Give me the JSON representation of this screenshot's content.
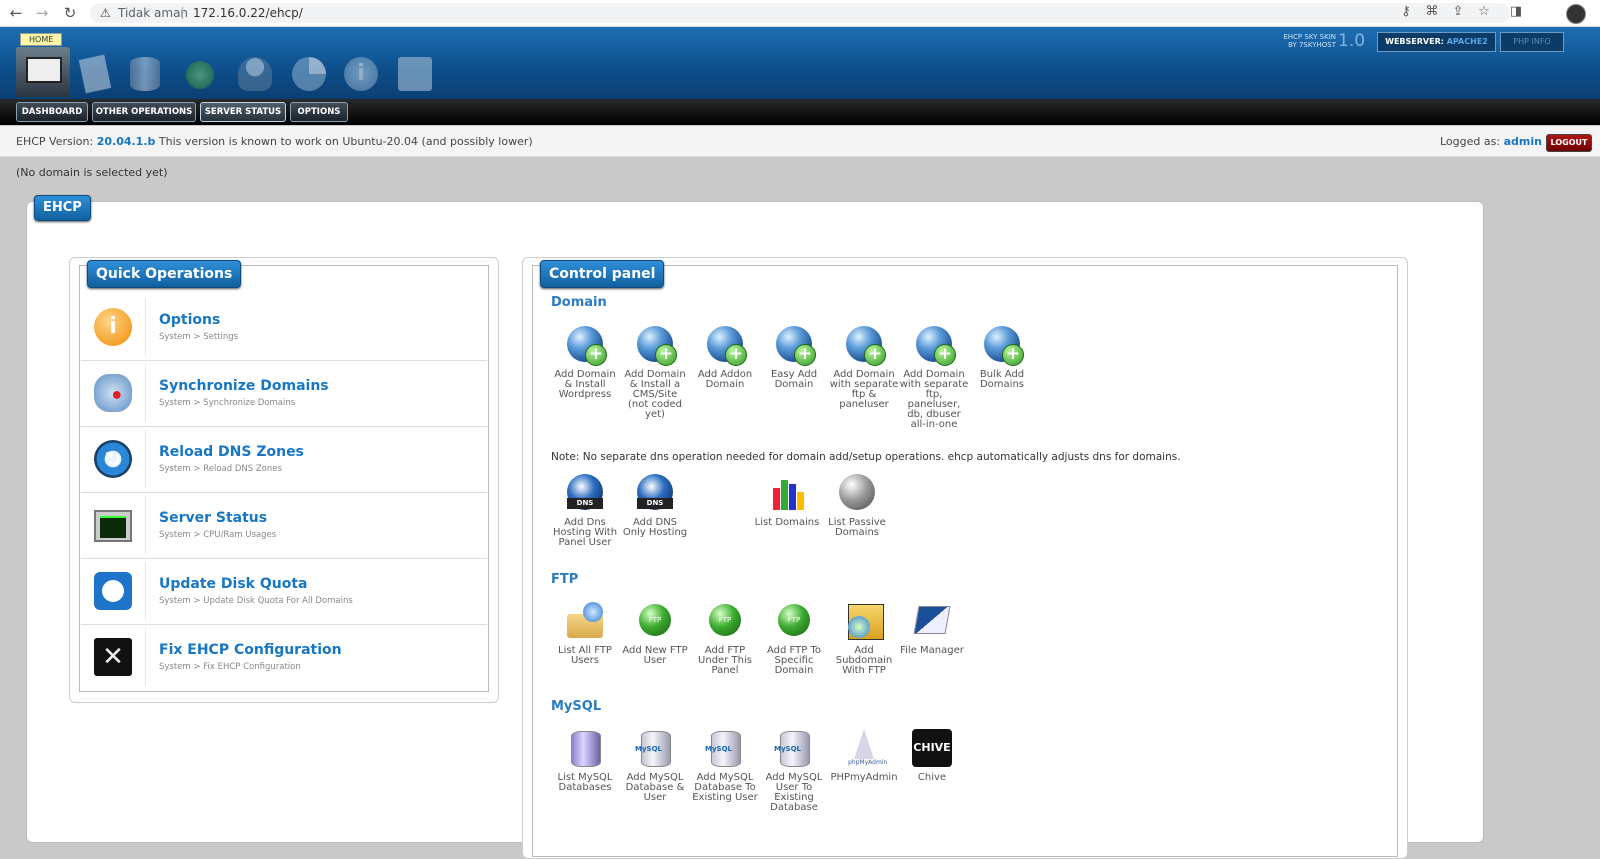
{
  "browser": {
    "security_label": "Tidak aman",
    "url": "172.16.0.22/ehcp/"
  },
  "header": {
    "home_tooltip": "HOME",
    "skin_line1": "EHCP SKY SKIN",
    "skin_line2": "BY 7SKYHOST",
    "skin_version": "1.0",
    "webserver_label": "WEBSERVER:",
    "webserver_value": "APACHE2",
    "php_info": "PHP INFO"
  },
  "menu": {
    "items": [
      "DASHBOARD",
      "OTHER OPERATIONS",
      "SERVER STATUS",
      "OPTIONS"
    ]
  },
  "version_bar": {
    "prefix": "EHCP Version:",
    "version": "20.04.1.b",
    "suffix": "This version is known to work on Ubuntu-20.04 (and possibly lower)",
    "logged_as": "Logged as:",
    "user": "admin",
    "logout": "LOGOUT"
  },
  "domain_status": "(No domain is selected yet)",
  "main": {
    "title": "EHCP",
    "quick_ops": {
      "title": "Quick Operations",
      "items": [
        {
          "title": "Options",
          "sub": "System > Settings",
          "icon": "info-icon"
        },
        {
          "title": "Synchronize Domains",
          "sub": "System > Synchronize Domains",
          "icon": "sync-icon"
        },
        {
          "title": "Reload DNS Zones",
          "sub": "System > Reload DNS Zones",
          "icon": "reload-icon"
        },
        {
          "title": "Server Status",
          "sub": "System > CPU/Ram Usages",
          "icon": "monitor-icon"
        },
        {
          "title": "Update Disk Quota",
          "sub": "System > Update Disk Quota For All Domains",
          "icon": "disk-icon"
        },
        {
          "title": "Fix EHCP Configuration",
          "sub": "System > Fix EHCP Configuration",
          "icon": "tools-icon"
        }
      ]
    },
    "control_panel": {
      "title": "Control panel",
      "domain_title": "Domain",
      "domain_items": [
        {
          "l1": "Add Domain",
          "l2": "& Install",
          "l3": "Wordpress",
          "l4": "",
          "l5": "",
          "l6": ""
        },
        {
          "l1": "Add Domain",
          "l2": "& Install a",
          "l3": "CMS/Site",
          "l4": "(not coded",
          "l5": "yet)",
          "l6": ""
        },
        {
          "l1": "Add Addon",
          "l2": "Domain",
          "l3": "",
          "l4": "",
          "l5": "",
          "l6": ""
        },
        {
          "l1": "Easy Add",
          "l2": "Domain",
          "l3": "",
          "l4": "",
          "l5": "",
          "l6": ""
        },
        {
          "l1": "Add Domain",
          "l2": "with separate",
          "l3": "ftp &",
          "l4": "paneluser",
          "l5": "",
          "l6": ""
        },
        {
          "l1": "Add Domain",
          "l2": "with separate",
          "l3": "ftp,",
          "l4": "paneluser,",
          "l5": "db, dbuser",
          "l6": "all-in-one"
        },
        {
          "l1": "Bulk Add",
          "l2": "Domains",
          "l3": "",
          "l4": "",
          "l5": "",
          "l6": ""
        }
      ],
      "note": "Note: No separate dns operation needed for domain add/setup operations. ehcp automatically adjusts dns for domains.",
      "dns_items": [
        {
          "l1": "Add Dns",
          "l2": "Hosting With",
          "l3": "Panel User",
          "badge": "DNS"
        },
        {
          "l1": "Add DNS",
          "l2": "Only Hosting",
          "l3": "",
          "badge": "DNS"
        },
        {
          "l1": "List Domains",
          "l2": "",
          "l3": ""
        },
        {
          "l1": "List Passive",
          "l2": "Domains",
          "l3": ""
        }
      ],
      "ftp_title": "FTP",
      "ftp_items": [
        {
          "l1": "List All FTP",
          "l2": "Users",
          "l3": ""
        },
        {
          "l1": "Add New FTP",
          "l2": "User",
          "l3": ""
        },
        {
          "l1": "Add FTP",
          "l2": "Under This",
          "l3": "Panel"
        },
        {
          "l1": "Add FTP To",
          "l2": "Specific",
          "l3": "Domain"
        },
        {
          "l1": "Add",
          "l2": "Subdomain",
          "l3": "With FTP"
        },
        {
          "l1": "File Manager",
          "l2": "",
          "l3": ""
        }
      ],
      "mysql_title": "MySQL",
      "mysql_items": [
        {
          "l1": "List MySQL",
          "l2": "Databases",
          "l3": "",
          "l4": ""
        },
        {
          "l1": "Add MySQL",
          "l2": "Database &",
          "l3": "User",
          "l4": ""
        },
        {
          "l1": "Add MySQL",
          "l2": "Database To",
          "l3": "Existing User",
          "l4": ""
        },
        {
          "l1": "Add MySQL",
          "l2": "User To",
          "l3": "Existing",
          "l4": "Database"
        },
        {
          "l1": "PHPmyAdmin",
          "l2": "",
          "l3": "",
          "l4": ""
        },
        {
          "l1": "Chive",
          "l2": "",
          "l3": "",
          "l4": ""
        }
      ],
      "icon_text": {
        "ftp": "FTP",
        "mysql": "MySQL",
        "chive": "CHIVE",
        "phpmyadmin": "phpMyAdmin"
      }
    }
  },
  "colors": {
    "accent": "#1877c4",
    "header": "#0d4e8a",
    "logout": "#8a0000"
  }
}
